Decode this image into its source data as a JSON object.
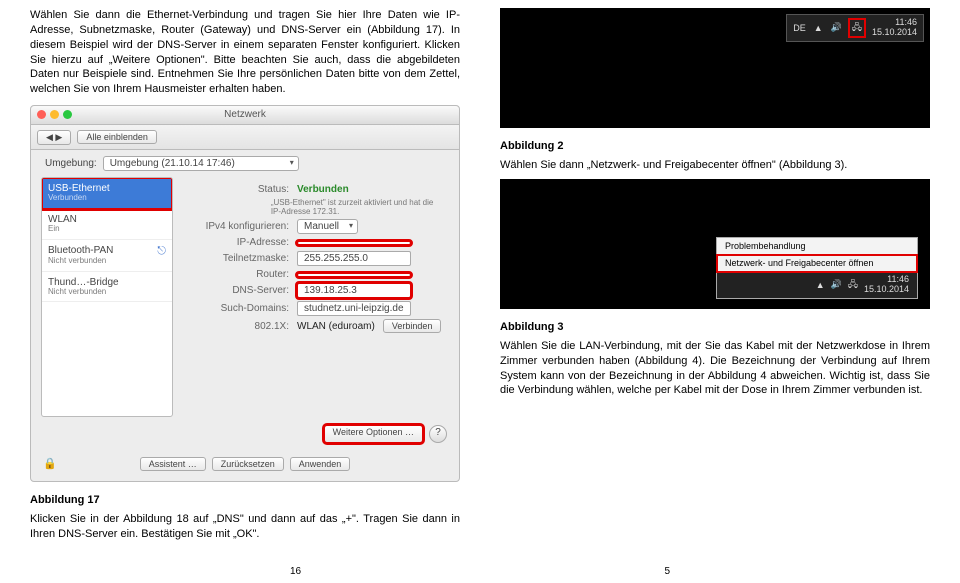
{
  "left": {
    "para1": "Wählen Sie dann die Ethernet-Verbindung und tragen Sie hier Ihre Daten wie IP-Adresse, Subnetzmaske, Router (Gateway) und DNS-Server ein (Abbildung 17). In diesem Beispiel wird der DNS-Server in einem separaten Fenster konfiguriert. Klicken Sie hierzu auf „Weitere Optionen\". Bitte beachten Sie auch, dass die abgebildeten Daten nur Beispiele sind. Entnehmen Sie Ihre persönlichen Daten bitte von dem Zettel, welchen Sie von Ihrem Hausmeister erhalten haben.",
    "fig17": {
      "windowTitle": "Netzwerk",
      "toolbarBack": "◀ ▶",
      "toolbarAll": "Alle einblenden",
      "envLabel": "Umgebung:",
      "envValue": "Umgebung (21.10.14 17:46)",
      "sidebar": [
        {
          "name": "USB-Ethernet",
          "sub": "Verbunden"
        },
        {
          "name": "WLAN",
          "sub": "Ein"
        },
        {
          "name": "Bluetooth-PAN",
          "sub": "Nicht verbunden"
        },
        {
          "name": "Thund…-Bridge",
          "sub": "Nicht verbunden"
        }
      ],
      "statusLabel": "Status:",
      "statusValue": "Verbunden",
      "statusNote": "„USB-Ethernet\" ist zurzeit aktiviert und hat die IP-Adresse 172.31.",
      "rows": [
        {
          "lab": "IPv4 konfigurieren:",
          "val": "Manuell",
          "type": "sel"
        },
        {
          "lab": "IP-Adresse:",
          "val": "",
          "type": "inp",
          "red": true
        },
        {
          "lab": "Teilnetzmaske:",
          "val": "255.255.255.0",
          "type": "inp"
        },
        {
          "lab": "Router:",
          "val": "",
          "type": "inp",
          "red": true
        },
        {
          "lab": "DNS-Server:",
          "val": "139.18.25.3",
          "type": "inp",
          "red": true
        },
        {
          "lab": "Such-Domains:",
          "val": "studnetz.uni-leipzig.de",
          "type": "inp"
        },
        {
          "lab": "802.1X:",
          "val": "WLAN (eduroam)",
          "btn": "Verbinden"
        }
      ],
      "moreBtn": "Weitere Optionen …",
      "bottomBtns": [
        "Assistent …",
        "Zurücksetzen",
        "Anwenden"
      ]
    },
    "caption17": "Abbildung 17",
    "para2": "Klicken Sie in der Abbildung 18 auf „DNS\" und dann auf das „+\". Tragen Sie dann in Ihren DNS-Server ein. Bestätigen Sie mit „OK\".",
    "pageNum": "16"
  },
  "right": {
    "tray": {
      "lang": "DE",
      "time": "11:46",
      "date": "15.10.2014",
      "icons": [
        "⚐",
        "🔊",
        "🖧"
      ]
    },
    "caption2": "Abbildung 2",
    "para2": "Wählen Sie dann „Netzwerk- und Freigabecenter öffnen\" (Abbildung 3).",
    "popup": {
      "items": [
        "Problembehandlung",
        "Netzwerk- und Freigabecenter öffnen"
      ],
      "tray": {
        "time": "11:46",
        "date": "15.10.2014"
      }
    },
    "caption3": "Abbildung 3",
    "para3": "Wählen Sie die LAN-Verbindung, mit der Sie das Kabel mit der Netzwerkdose in Ihrem Zimmer verbunden haben (Abbildung 4). Die Bezeichnung der Verbindung auf Ihrem System kann von der Bezeichnung in der Abbildung 4 abweichen. Wichtig ist, dass Sie die Verbindung wählen, welche per Kabel mit der Dose in Ihrem Zimmer verbunden ist.",
    "pageNum": "5"
  }
}
